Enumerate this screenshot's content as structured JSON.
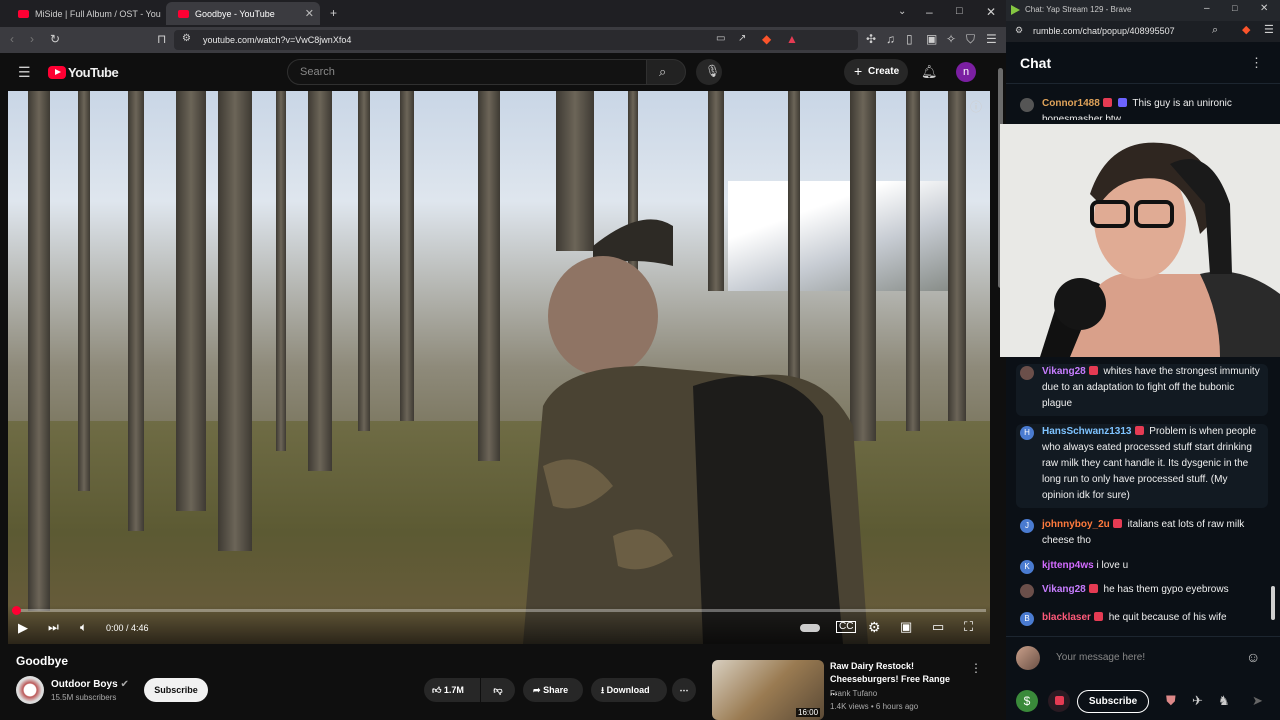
{
  "browser": {
    "tabs": [
      {
        "label": "MiSide | Full Album / OST - You"
      },
      {
        "label": "Goodbye - YouTube"
      }
    ],
    "url": "youtube.com/watch?v=VwC8jwnXfo4"
  },
  "youtube": {
    "logo": "YouTube",
    "search_placeholder": "Search",
    "create_label": "Create",
    "avatar_letter": "n",
    "player": {
      "time": "0:00 / 4:46",
      "progress_fraction": 0.0
    },
    "video": {
      "title": "Goodbye",
      "channel": "Outdoor Boys",
      "subscribers": "15.5M subscribers",
      "subscribe_label": "Subscribe",
      "likes": "1.7M",
      "share_label": "Share",
      "download_label": "Download"
    },
    "recommended": {
      "title": "Raw Dairy Restock! Cheeseburgers! Free Range ...",
      "channel": "Frank Tufano",
      "meta": "1.4K views • 6 hours ago",
      "duration": "16:00"
    }
  },
  "chat": {
    "window_title": "Chat: Yap Stream 129 - Brave",
    "url": "rumble.com/chat/popup/408995507",
    "header": "Chat",
    "messages": [
      {
        "user": "Connor1488",
        "text": "This guy is an unironic bonesmasher btw",
        "color": "#e0a35a",
        "avatar": ""
      },
      {
        "user": "Vikang28",
        "text": "whites have the strongest immunity due to an adaptation to fight off the bubonic plague",
        "color": "#c77dff",
        "avatar": ""
      },
      {
        "user": "HansSchwanz1313",
        "text": "Problem is when people who always eated processed stuff start drinking raw milk they cant handle it. Its dysgenic in the long run to only have processed stuff. (My opinion idk for sure)",
        "color": "#7ec3ff",
        "avatar": "H"
      },
      {
        "user": "johnnyboy_2u",
        "text": "italians eat lots of raw milk cheese tho",
        "color": "#ff7a3d",
        "avatar": "J"
      },
      {
        "user": "kjttenp4ws",
        "text": "i love u",
        "color": "#d36bff",
        "avatar": "K"
      },
      {
        "user": "Vikang28",
        "text": "he has them gypo eyebrows",
        "color": "#c77dff",
        "avatar": ""
      },
      {
        "user": "blacklaser",
        "text": "he quit because of his wife",
        "color": "#ff5a7a",
        "avatar": "B"
      }
    ],
    "input_placeholder": "Your message here!",
    "subscribe_label": "Subscribe"
  }
}
